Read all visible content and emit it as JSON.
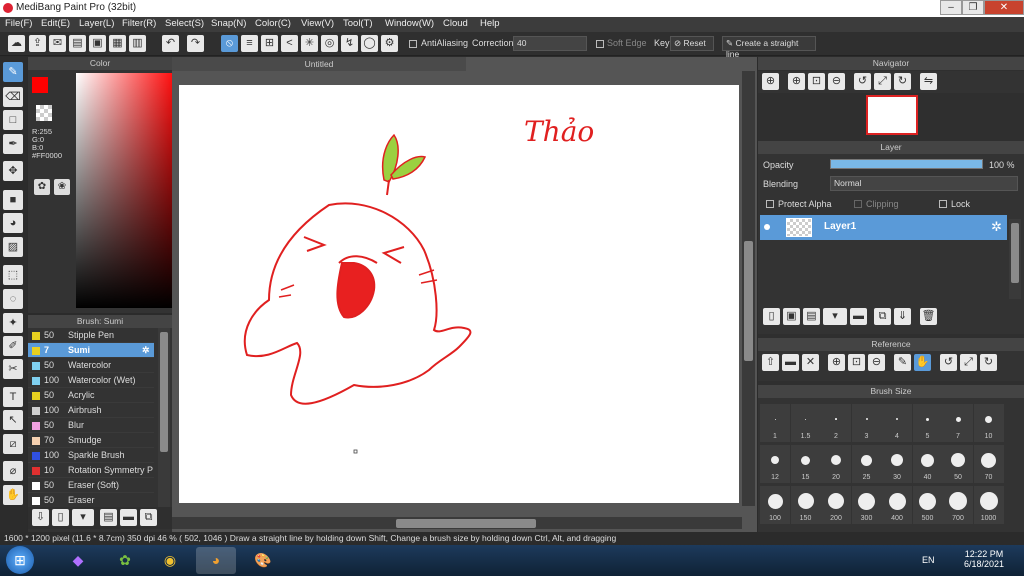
{
  "window": {
    "title": "MediBang Paint Pro (32bit)"
  },
  "menu": [
    "File(F)",
    "Edit(E)",
    "Layer(L)",
    "Filter(R)",
    "Select(S)",
    "Snap(N)",
    "Color(C)",
    "View(V)",
    "Tool(T)",
    "Window(W)",
    "Cloud",
    "Help"
  ],
  "toolbar": {
    "antialiasing_label": "AntiAliasing",
    "correction_label": "Correction",
    "correction_value": "40",
    "soft_edge_label": "Soft Edge",
    "key_label": "Key",
    "reset_label": "Reset",
    "straight_line_label": "Create a straight line"
  },
  "color_panel": {
    "title": "Color",
    "r": "R:255",
    "g": "G:0",
    "b": "B:0",
    "hex": "#FF0000",
    "current_color": "#ff0000"
  },
  "brush_panel": {
    "title": "Brush: Sumi",
    "items": [
      {
        "size": "50",
        "name": "Stipple Pen",
        "color": "#e8d020"
      },
      {
        "size": "7",
        "name": "Sumi",
        "color": "#e8d020"
      },
      {
        "size": "50",
        "name": "Watercolor",
        "color": "#7fd0f0"
      },
      {
        "size": "100",
        "name": "Watercolor (Wet)",
        "color": "#7fd0f0"
      },
      {
        "size": "50",
        "name": "Acrylic",
        "color": "#e8d020"
      },
      {
        "size": "100",
        "name": "Airbrush",
        "color": "#cfcfcf"
      },
      {
        "size": "50",
        "name": "Blur",
        "color": "#f0a0e0"
      },
      {
        "size": "70",
        "name": "Smudge",
        "color": "#f5d0b0"
      },
      {
        "size": "100",
        "name": "Sparkle Brush",
        "color": "#3050e0"
      },
      {
        "size": "10",
        "name": "Rotation Symmetry P",
        "color": "#e03030"
      },
      {
        "size": "50",
        "name": "Eraser (Soft)",
        "color": "#ffffff"
      },
      {
        "size": "50",
        "name": "Eraser",
        "color": "#ffffff"
      }
    ]
  },
  "canvas": {
    "tab_title": "Untitled",
    "handwriting": "Thảo"
  },
  "navigator": {
    "title": "Navigator"
  },
  "layer_panel": {
    "title": "Layer",
    "opacity_label": "Opacity",
    "opacity_value": "100 %",
    "opacity_level": 1.0,
    "blending_label": "Blending",
    "blending_value": "Normal",
    "protect_alpha": "Protect Alpha",
    "clipping": "Clipping",
    "lock": "Lock",
    "layer_name": "Layer1"
  },
  "reference": {
    "title": "Reference"
  },
  "brush_size": {
    "title": "Brush Size",
    "sizes": [
      "1",
      "1.5",
      "2",
      "3",
      "4",
      "5",
      "7",
      "10",
      "12",
      "15",
      "20",
      "25",
      "30",
      "40",
      "50",
      "70",
      "100",
      "150",
      "200",
      "300",
      "400",
      "500",
      "700",
      "1000"
    ]
  },
  "status": {
    "text": "1600 * 1200 pixel   (11.6 * 8.7cm)   350 dpi   46 %   ( 502, 1046 )   Draw a straight line by holding down Shift, Change a brush size by holding down Ctrl, Alt, and dragging"
  },
  "taskbar": {
    "lang": "EN",
    "time": "12:22 PM",
    "date": "6/18/2021"
  }
}
